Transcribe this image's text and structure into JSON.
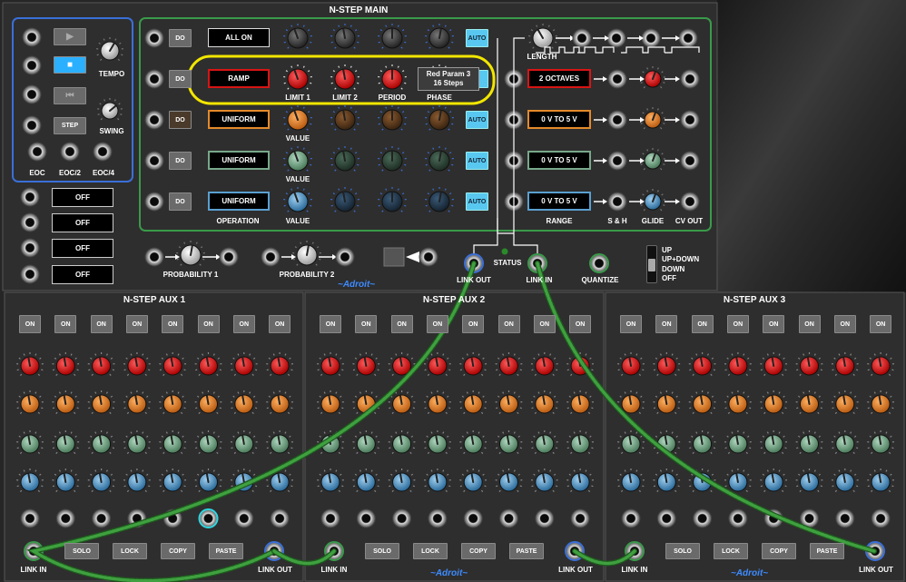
{
  "main": {
    "title": "N-STEP MAIN",
    "brand": "~Adroit~",
    "do_label": "DO",
    "displays": [
      "ALL ON",
      "RAMP",
      "UNIFORM",
      "UNIFORM",
      "UNIFORM"
    ],
    "range_displays": [
      "2 OCTAVES",
      "0 V TO 5 V",
      "0 V TO 5 V",
      "0 V TO 5 V"
    ],
    "tooltip": {
      "line1": "Red Param 3",
      "line2": "16 Steps"
    },
    "labels": {
      "tempo": "TEMPO",
      "step": "STEP",
      "swing": "SWING",
      "eoc": "EOC",
      "eoc2": "EOC/2",
      "eoc4": "EOC/4",
      "limit1": "LIMIT 1",
      "limit2": "LIMIT 2",
      "period": "PERIOD",
      "phase": "PHASE",
      "value": "VALUE",
      "operation": "OPERATION",
      "length": "LENGTH",
      "range": "RANGE",
      "sh": "S & H",
      "glide": "GLIDE",
      "cv_out": "CV OUT",
      "probability1": "PROBABILITY 1",
      "probability2": "PROBABILITY 2",
      "link_out": "LINK OUT",
      "link_in": "LINK IN",
      "status": "STATUS",
      "quantize": "QUANTIZE",
      "auto": "AUTO"
    },
    "off_buttons": [
      "OFF",
      "OFF",
      "OFF",
      "OFF"
    ],
    "direction_switch": [
      "UP",
      "UP+DOWN",
      "DOWN",
      "OFF"
    ]
  },
  "aux": [
    {
      "title": "N-STEP AUX 1",
      "on_labels": [
        "ON",
        "ON",
        "ON",
        "ON",
        "ON",
        "ON",
        "ON",
        "ON"
      ],
      "buttons": [
        "SOLO",
        "LOCK",
        "COPY",
        "PASTE"
      ],
      "link_in": "LINK IN",
      "link_out": "LINK OUT"
    },
    {
      "title": "N-STEP AUX 2",
      "on_labels": [
        "ON",
        "ON",
        "ON",
        "ON",
        "ON",
        "ON",
        "ON",
        "ON"
      ],
      "buttons": [
        "SOLO",
        "LOCK",
        "COPY",
        "PASTE"
      ],
      "link_in": "LINK IN",
      "link_out": "LINK OUT",
      "brand": "~Adroit~"
    },
    {
      "title": "N-STEP AUX 3",
      "on_labels": [
        "ON",
        "ON",
        "ON",
        "ON",
        "ON",
        "ON",
        "ON",
        "ON"
      ],
      "buttons": [
        "SOLO",
        "LOCK",
        "COPY",
        "PASTE"
      ],
      "link_in": "LINK IN",
      "link_out": "LINK OUT",
      "brand": "~Adroit~"
    }
  ],
  "colors": {
    "red": "#d91414",
    "orange": "#e58a2a",
    "green": "#78a88a",
    "blue": "#5aa0d0",
    "highlight": "#f2e600",
    "cable": "#2f8a2f",
    "auto": "#59c8f0",
    "panel_border_blue": "#3a6fd8",
    "panel_border_green": "#3a9a4a"
  }
}
